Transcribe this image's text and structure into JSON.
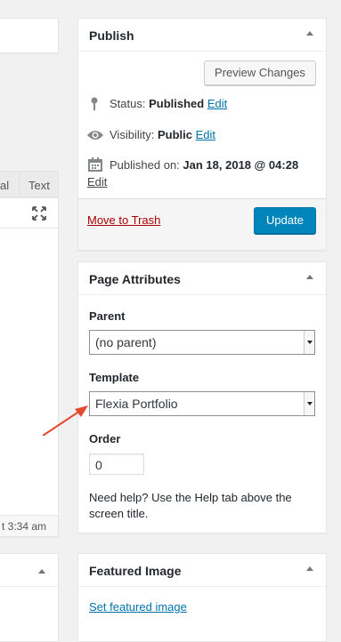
{
  "editor": {
    "tab_visual": "al",
    "tab_text": "Text",
    "status_text": "t 3:34 am"
  },
  "publish": {
    "title": "Publish",
    "preview_label": "Preview Changes",
    "status_label": "Status:",
    "status_value": "Published",
    "status_edit": "Edit",
    "visibility_label": "Visibility:",
    "visibility_value": "Public",
    "visibility_edit": "Edit",
    "published_label": "Published on:",
    "published_value": "Jan 18, 2018 @ 04:28",
    "published_edit": "Edit",
    "trash_label": "Move to Trash",
    "update_label": "Update"
  },
  "page_attributes": {
    "title": "Page Attributes",
    "parent_label": "Parent",
    "parent_value": "(no parent)",
    "template_label": "Template",
    "template_value": "Flexia Portfolio",
    "order_label": "Order",
    "order_value": "0",
    "help_text": "Need help? Use the Help tab above the screen title."
  },
  "featured_image": {
    "title": "Featured Image",
    "set_label": "Set featured image"
  },
  "colors": {
    "link": "#0073aa",
    "trash": "#a00000",
    "primary": "#0085ba",
    "arrow": "#e2492f"
  }
}
